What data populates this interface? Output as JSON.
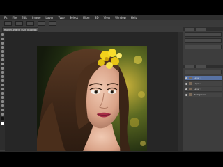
{
  "app": {
    "name": "Photoshop",
    "accent": "#5872a3"
  },
  "menus": [
    "Ps",
    "File",
    "Edit",
    "Image",
    "Layer",
    "Type",
    "Select",
    "Filter",
    "3D",
    "View",
    "Window",
    "Help"
  ],
  "document": {
    "tab_label": "model.psd @ 50% (RGB/8)"
  },
  "layers": [
    {
      "name": "Layer 3",
      "selected": true
    },
    {
      "name": "Layer 2",
      "selected": false
    },
    {
      "name": "Layer 1",
      "selected": false
    },
    {
      "name": "Background",
      "selected": false
    }
  ],
  "photo": {
    "subject": "woman-portrait",
    "flower_color": "#f2d21b"
  }
}
